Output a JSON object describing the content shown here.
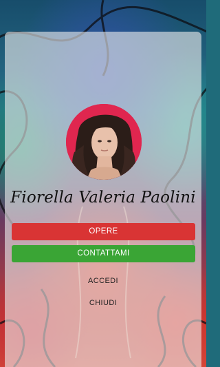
{
  "profile": {
    "name": "Fiorella Valeria Paolini",
    "avatar_icon": "portrait-photo"
  },
  "actions": {
    "opere_label": "OPERE",
    "contattami_label": "CONTATTAMI",
    "accedi_label": "ACCEDI",
    "chiudi_label": "CHIUDI"
  },
  "colors": {
    "opere_button": "#d93434",
    "contattami_button": "#3aa535",
    "avatar_background": "#e0264f",
    "card_overlay": "rgba(235,235,235,0.62)"
  },
  "background": {
    "icon": "abstract-painting-background"
  }
}
